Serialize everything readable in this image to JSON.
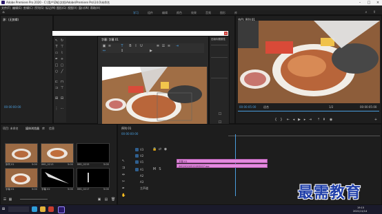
{
  "window": {
    "title": "Adobe Premiere Pro 2020 - C:\\用户\\Dbj\\文档\\Adobe\\Premiere Pro\\14.0\\未命名"
  },
  "menu": [
    "文件(F)",
    "编辑(E)",
    "剪辑(C)",
    "序列(S)",
    "标记(M)",
    "图形(G)",
    "视图(V)",
    "窗口(W)",
    "帮助(H)"
  ],
  "workspaces": [
    "学习",
    "组件",
    "编辑",
    "颜色",
    "效果",
    "音频",
    "图形",
    "库"
  ],
  "source": {
    "tab": "源：(无剪辑)",
    "timecode": "00:00:00:00"
  },
  "titler": {
    "tab": "字幕: 字幕 01",
    "styles_tab": "旧版标题样式",
    "aa_label": "Aa",
    "properties_tab": "旧版标题属性"
  },
  "program": {
    "tab": "节目: 序列 01",
    "timecode": "00:00:05:00",
    "fit": "适合",
    "ratio": "1/2",
    "duration": "00:00:05:00"
  },
  "project": {
    "tabs": [
      "项目: 未命名",
      "媒体浏览器",
      "库",
      "信息"
    ],
    "items": [
      {
        "name": "序列 01",
        "duration": "5:00"
      },
      {
        "name": "IMG_0213",
        "duration": "5:00"
      },
      {
        "name": "IMG_0215",
        "duration": "5:00"
      },
      {
        "name": "字幕 01",
        "duration": "5:00"
      },
      {
        "name": "字幕 02",
        "duration": "5:00"
      },
      {
        "name": "IMG_0217",
        "duration": "5:00"
      }
    ]
  },
  "timeline": {
    "tab": "序列 01",
    "timecode": "00:00:00:00",
    "tracks": [
      "V3",
      "V2",
      "V1",
      "A1",
      "A2",
      "A3"
    ],
    "clips": [
      {
        "label": "字幕 01"
      },
      {
        "label": "IMG20200512093007.jpg"
      }
    ],
    "mix": "主声道"
  },
  "taskbar": {
    "time": "19:15",
    "date": "2021/11/14"
  },
  "watermark": "最需教育",
  "colors": {
    "accent": "#4a9fe0",
    "clip": "#e58ae0",
    "close": "#c8312c",
    "watermark": "#1f3ea8"
  }
}
